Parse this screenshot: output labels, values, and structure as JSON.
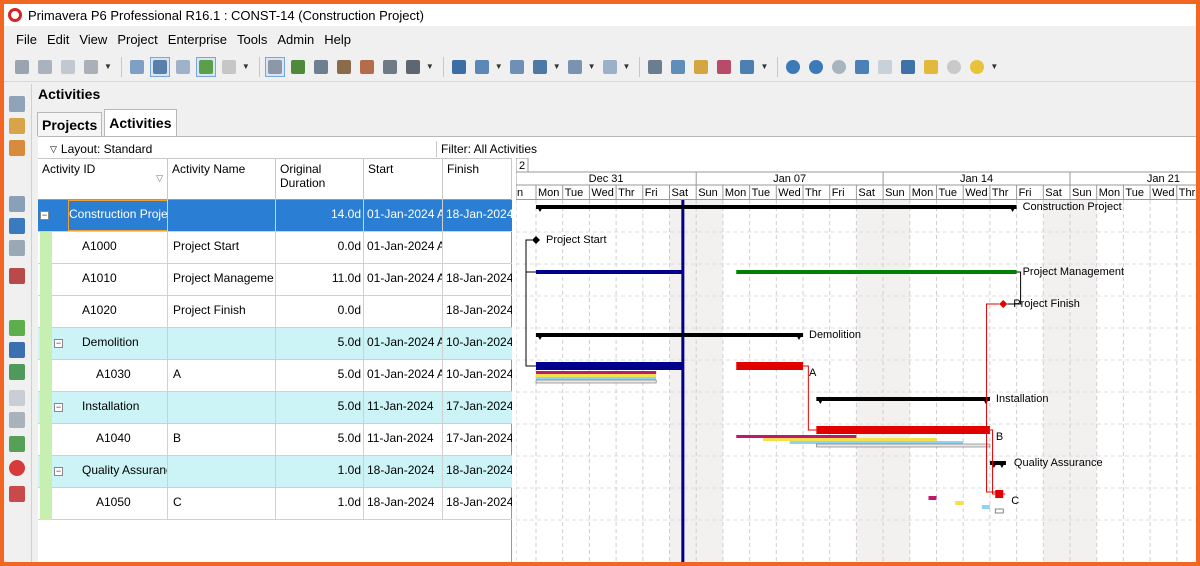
{
  "window": {
    "title": "Primavera P6 Professional R16.1 : CONST-14 (Construction Project)"
  },
  "menu": [
    "File",
    "Edit",
    "View",
    "Project",
    "Enterprise",
    "Tools",
    "Admin",
    "Help"
  ],
  "section_title": "Activities",
  "tabs": [
    {
      "label": "Projects",
      "selected": false
    },
    {
      "label": "Activities",
      "selected": true
    }
  ],
  "layout_label": "Layout: Standard",
  "filter_label": "Filter: All Activities",
  "columns": {
    "activity_id": "Activity ID",
    "activity_name": "Activity Name",
    "original_duration": "Original Duration",
    "start": "Start",
    "finish": "Finish"
  },
  "rows": [
    {
      "type": "project",
      "id": "Construction Project",
      "name": "",
      "duration": "14.0d",
      "start": "01-Jan-2024 A",
      "finish": "18-Jan-2024",
      "selected": true
    },
    {
      "type": "activity",
      "id": "A1000",
      "name": "Project Start",
      "duration": "0.0d",
      "start": "01-Jan-2024 A",
      "finish": ""
    },
    {
      "type": "activity",
      "id": "A1010",
      "name": "Project Management",
      "duration": "11.0d",
      "start": "01-Jan-2024 A",
      "finish": "18-Jan-2024"
    },
    {
      "type": "activity",
      "id": "A1020",
      "name": "Project Finish",
      "duration": "0.0d",
      "start": "",
      "finish": "18-Jan-2024"
    },
    {
      "type": "wbs",
      "id": "Demolition",
      "name": "",
      "duration": "5.0d",
      "start": "01-Jan-2024 A",
      "finish": "10-Jan-2024"
    },
    {
      "type": "activity",
      "id": "A1030",
      "name": "A",
      "duration": "5.0d",
      "start": "01-Jan-2024 A",
      "finish": "10-Jan-2024"
    },
    {
      "type": "wbs",
      "id": "Installation",
      "name": "",
      "duration": "5.0d",
      "start": "11-Jan-2024",
      "finish": "17-Jan-2024"
    },
    {
      "type": "activity",
      "id": "A1040",
      "name": "B",
      "duration": "5.0d",
      "start": "11-Jan-2024",
      "finish": "17-Jan-2024"
    },
    {
      "type": "wbs",
      "id": "Quality Assurance",
      "name": "",
      "duration": "1.0d",
      "start": "18-Jan-2024",
      "finish": "18-Jan-2024"
    },
    {
      "type": "activity",
      "id": "A1050",
      "name": "C",
      "duration": "1.0d",
      "start": "18-Jan-2024",
      "finish": "18-Jan-2024"
    }
  ],
  "gantt": {
    "timescale_level": "2",
    "weeks": [
      "Dec 31",
      "Jan 07",
      "Jan 14",
      "Jan 21"
    ],
    "days": [
      "n",
      "Mon",
      "Tue",
      "Wed",
      "Thr",
      "Fri",
      "Sat",
      "Sun",
      "Mon",
      "Tue",
      "Wed",
      "Thr",
      "Fri",
      "Sat",
      "Sun",
      "Mon",
      "Tue",
      "Wed",
      "Thr",
      "Fri",
      "Sat",
      "Sun",
      "Mon",
      "Tue",
      "Wed",
      "Thr"
    ],
    "bar_labels": [
      "Construction Project",
      "Project Start",
      "Project Management",
      "Project Finish",
      "Demolition",
      "A",
      "Installation",
      "B",
      "Quality Assurance",
      "C"
    ],
    "colors": {
      "summary": "#000000",
      "actual": "#00008b",
      "remaining": "#008000",
      "critical": "#e00000",
      "data_date": "#00008b",
      "baseline_1": "#c0186c",
      "baseline_2": "#f4e04d",
      "baseline_3": "#8fd3f4",
      "baseline_4": "#e8e8e8"
    }
  }
}
